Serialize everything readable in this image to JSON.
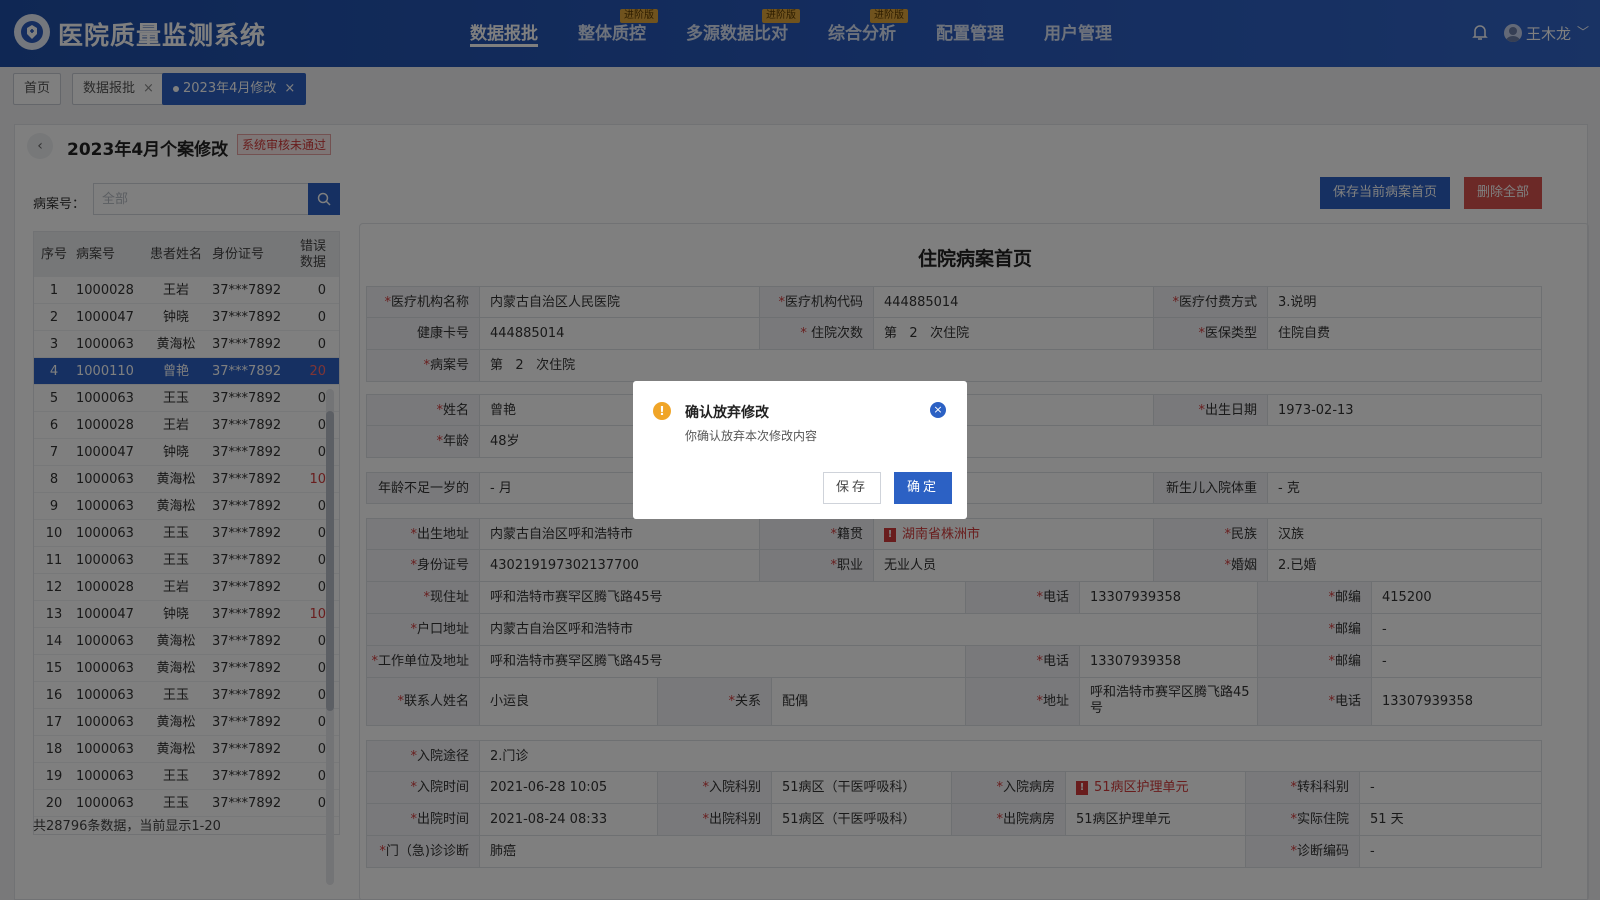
{
  "app": {
    "title": "医院质量监测系统"
  },
  "nav": [
    {
      "label": "数据报批",
      "badge": ""
    },
    {
      "label": "整体质控",
      "badge": "进阶版"
    },
    {
      "label": "多源数据比对",
      "badge": "进阶版"
    },
    {
      "label": "综合分析",
      "badge": "进阶版"
    },
    {
      "label": "配置管理",
      "badge": ""
    },
    {
      "label": "用户管理",
      "badge": ""
    }
  ],
  "user": {
    "name": "王木龙",
    "caret": "﹀"
  },
  "tabs": [
    {
      "label": "首页"
    },
    {
      "label": "数据报批",
      "close": "×"
    },
    {
      "label": "2023年4月修改",
      "close": "×"
    }
  ],
  "page": {
    "back": "‹",
    "title": "2023年4月个案修改",
    "status": "系统审核未通过"
  },
  "search": {
    "label": "病案号：",
    "placeholder": "全部"
  },
  "list": {
    "headers": {
      "idx": "序号",
      "no": "病案号",
      "name": "患者姓名",
      "id": "身份证号",
      "err": "错误数据"
    },
    "rows": [
      {
        "idx": "1",
        "no": "1000028",
        "name": "王岩",
        "id": "37***7892",
        "err": "0"
      },
      {
        "idx": "2",
        "no": "1000047",
        "name": "钟晓",
        "id": "37***7892",
        "err": "0"
      },
      {
        "idx": "3",
        "no": "1000063",
        "name": "黄海松",
        "id": "37***7892",
        "err": "0"
      },
      {
        "idx": "4",
        "no": "1000110",
        "name": "曾艳",
        "id": "37***7892",
        "err": "20"
      },
      {
        "idx": "5",
        "no": "1000063",
        "name": "王玉",
        "id": "37***7892",
        "err": "0"
      },
      {
        "idx": "6",
        "no": "1000028",
        "name": "王岩",
        "id": "37***7892",
        "err": "0"
      },
      {
        "idx": "7",
        "no": "1000047",
        "name": "钟晓",
        "id": "37***7892",
        "err": "0"
      },
      {
        "idx": "8",
        "no": "1000063",
        "name": "黄海松",
        "id": "37***7892",
        "err": "10"
      },
      {
        "idx": "9",
        "no": "1000063",
        "name": "黄海松",
        "id": "37***7892",
        "err": "0"
      },
      {
        "idx": "10",
        "no": "1000063",
        "name": "王玉",
        "id": "37***7892",
        "err": "0"
      },
      {
        "idx": "11",
        "no": "1000063",
        "name": "王玉",
        "id": "37***7892",
        "err": "0"
      },
      {
        "idx": "12",
        "no": "1000028",
        "name": "王岩",
        "id": "37***7892",
        "err": "0"
      },
      {
        "idx": "13",
        "no": "1000047",
        "name": "钟晓",
        "id": "37***7892",
        "err": "10"
      },
      {
        "idx": "14",
        "no": "1000063",
        "name": "黄海松",
        "id": "37***7892",
        "err": "0"
      },
      {
        "idx": "15",
        "no": "1000063",
        "name": "黄海松",
        "id": "37***7892",
        "err": "0"
      },
      {
        "idx": "16",
        "no": "1000063",
        "name": "王玉",
        "id": "37***7892",
        "err": "0"
      },
      {
        "idx": "17",
        "no": "1000063",
        "name": "黄海松",
        "id": "37***7892",
        "err": "0"
      },
      {
        "idx": "18",
        "no": "1000063",
        "name": "黄海松",
        "id": "37***7892",
        "err": "0"
      },
      {
        "idx": "19",
        "no": "1000063",
        "name": "王玉",
        "id": "37***7892",
        "err": "0"
      },
      {
        "idx": "20",
        "no": "1000063",
        "name": "王玉",
        "id": "37***7892",
        "err": "0"
      }
    ],
    "footer": "共28796条数据，当前显示1-20"
  },
  "actions": {
    "save_first": "保存当前病案首页",
    "delete_all": "删除全部"
  },
  "form": {
    "title": "住院病案首页",
    "org_name_lbl": "医疗机构名称",
    "org_name": "内蒙古自治区人民医院",
    "org_code_lbl": "医疗机构代码",
    "org_code": "444885014",
    "pay_lbl": "医疗付费方式",
    "pay": "3.说明",
    "health_card_lbl": "健康卡号",
    "health_card": "444885014",
    "visits_lbl": "住院次数",
    "visits": "第   2   次住院",
    "ins_lbl": "医保类型",
    "ins": "住院自费",
    "case_no_lbl": "病案号",
    "case_no": "第   2   次住院",
    "name_lbl": "姓名",
    "name": "曾艳",
    "birth_lbl": "出生日期",
    "birth": "1973-02-13",
    "age_lbl": "年龄",
    "age": "48岁",
    "infant_age_lbl": "年龄不足一岁的",
    "infant_age": "- 月",
    "newborn_wt_lbl": "新生儿入院体重",
    "newborn_wt": "- 克",
    "birthplace_lbl": "出生地址",
    "birthplace": "内蒙古自治区呼和浩特市",
    "native_lbl": "籍贯",
    "native": "湖南省株洲市",
    "nation_lbl": "民族",
    "nation": "汉族",
    "idcard_lbl": "身份证号",
    "idcard": "430219197302137700",
    "job_lbl": "职业",
    "job": "无业人员",
    "marital_lbl": "婚姻",
    "marital": "2.已婚",
    "addr_lbl": "现住址",
    "addr": "呼和浩特市赛罕区腾飞路45号",
    "phone_lbl": "电话",
    "phone": "13307939358",
    "zip_lbl": "邮编",
    "zip": "415200",
    "hukou_lbl": "户口地址",
    "hukou": "内蒙古自治区呼和浩特市",
    "zip2_lbl": "邮编",
    "zip2": "-",
    "work_lbl": "工作单位及地址",
    "work": "呼和浩特市赛罕区腾飞路45号",
    "phone2_lbl": "电话",
    "phone2": "13307939358",
    "zip3_lbl": "邮编",
    "zip3": "-",
    "contact_lbl": "联系人姓名",
    "contact": "小运良",
    "rel_lbl": "关系",
    "rel": "配偶",
    "caddr_lbl": "地址",
    "caddr": "呼和浩特市赛罕区腾飞路45号",
    "cphone_lbl": "电话",
    "cphone": "13307939358",
    "route_lbl": "入院途径",
    "route": "2.门诊",
    "admit_time_lbl": "入院时间",
    "admit_time": "2021-06-28 10:05",
    "admit_dept_lbl": "入院科别",
    "admit_dept": "51病区（干医呼吸科）",
    "admit_ward_lbl": "入院病房",
    "admit_ward": "51病区护理单元",
    "transfer_lbl": "转科科别",
    "transfer": "-",
    "dis_time_lbl": "出院时间",
    "dis_time": "2021-08-24 08:33",
    "dis_dept_lbl": "出院科别",
    "dis_dept": "51病区（干医呼吸科）",
    "dis_ward_lbl": "出院病房",
    "dis_ward": "51病区护理单元",
    "stay_lbl": "实际住院",
    "stay": "51 天",
    "diag_lbl": "门（急)诊诊断",
    "diag": "肺癌",
    "diag_code_lbl": "诊断编码",
    "diag_code": "-"
  },
  "modal": {
    "title": "确认放弃修改",
    "message": "你确认放弃本次修改内容",
    "save": "保存",
    "ok": "确定",
    "close": "×",
    "warn": "!"
  }
}
